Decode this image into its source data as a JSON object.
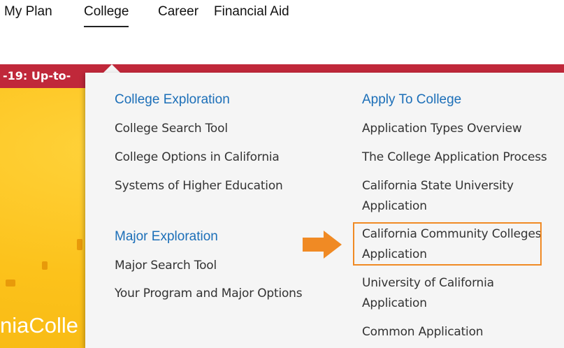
{
  "nav": {
    "items": [
      "My Plan",
      "College",
      "Career",
      "Financial Aid"
    ],
    "active": "College"
  },
  "alert": {
    "text": "-19: Up-to-"
  },
  "hero": {
    "brand_text": "niaColle"
  },
  "dropdown": {
    "college_exploration": {
      "title": "College Exploration",
      "links": [
        "College Search Tool",
        "College Options in California",
        "Systems of Higher Education"
      ]
    },
    "major_exploration": {
      "title": "Major Exploration",
      "links": [
        "Major Search Tool",
        "Your Program and Major Options"
      ]
    },
    "apply_to_college": {
      "title": "Apply To College",
      "links": [
        [
          "Application Types Overview"
        ],
        [
          "The College Application Process"
        ],
        [
          "California State University",
          "Application"
        ],
        [
          "California Community Colleges",
          "Application"
        ],
        [
          "University of California",
          "Application"
        ],
        [
          "Common Application"
        ]
      ]
    }
  },
  "colors": {
    "accent_blue": "#1c6fb8",
    "alert_red": "#c0283a",
    "highlight_orange": "#f08a24",
    "hero_yellow": "#fcc21b"
  },
  "icons": {
    "pointer": "arrow-right-icon"
  }
}
